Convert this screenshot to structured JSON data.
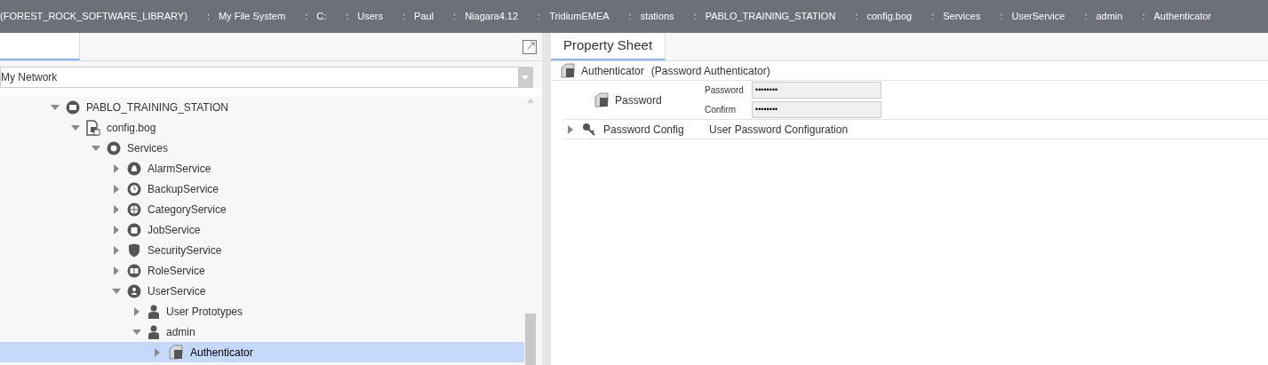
{
  "breadcrumb": {
    "separator": ":",
    "items": [
      "(FOREST_ROCK_SOFTWARE_LIBRARY)",
      "My File System",
      "C:",
      "Users",
      "Paul",
      "Niagara4.12",
      "TridiumEMEA",
      "stations",
      "PABLO_TRAINING_STATION",
      "config.bog",
      "Services",
      "UserService",
      "admin",
      "Authenticator"
    ]
  },
  "nav": {
    "selector": "My Network",
    "tree": [
      {
        "label": "PABLO_TRAINING_STATION",
        "kind": "folder",
        "expanded": true,
        "selected": false,
        "children": [
          {
            "label": "config.bog",
            "kind": "file",
            "expanded": true,
            "selected": false,
            "children": [
              {
                "label": "Services",
                "kind": "services",
                "expanded": true,
                "selected": false,
                "children": [
                  {
                    "label": "AlarmService",
                    "kind": "alarm",
                    "expanded": false,
                    "selected": false
                  },
                  {
                    "label": "BackupService",
                    "kind": "backup",
                    "expanded": false,
                    "selected": false
                  },
                  {
                    "label": "CategoryService",
                    "kind": "category",
                    "expanded": false,
                    "selected": false
                  },
                  {
                    "label": "JobService",
                    "kind": "job",
                    "expanded": false,
                    "selected": false
                  },
                  {
                    "label": "SecurityService",
                    "kind": "security",
                    "expanded": false,
                    "selected": false
                  },
                  {
                    "label": "RoleService",
                    "kind": "role",
                    "expanded": false,
                    "selected": false
                  },
                  {
                    "label": "UserService",
                    "kind": "userservice",
                    "expanded": true,
                    "selected": false,
                    "children": [
                      {
                        "label": "User Prototypes",
                        "kind": "user",
                        "expanded": false,
                        "selected": false
                      },
                      {
                        "label": "admin",
                        "kind": "user",
                        "expanded": true,
                        "selected": false,
                        "children": [
                          {
                            "label": "Authenticator",
                            "kind": "component",
                            "expanded": false,
                            "selected": true
                          }
                        ]
                      }
                    ]
                  }
                ]
              }
            ]
          }
        ]
      }
    ]
  },
  "view": {
    "tab": {
      "label": "Property Sheet",
      "selected": true
    },
    "header": {
      "name": "Authenticator",
      "type": "(Password Authenticator)"
    },
    "password": {
      "label": "Password",
      "fields": [
        {
          "label": "Password",
          "value": "••••••••"
        },
        {
          "label": "Confirm",
          "value": "••••••••"
        }
      ]
    },
    "config": {
      "label": "Password Config",
      "value": "User Password Configuration",
      "expanded": false
    }
  }
}
